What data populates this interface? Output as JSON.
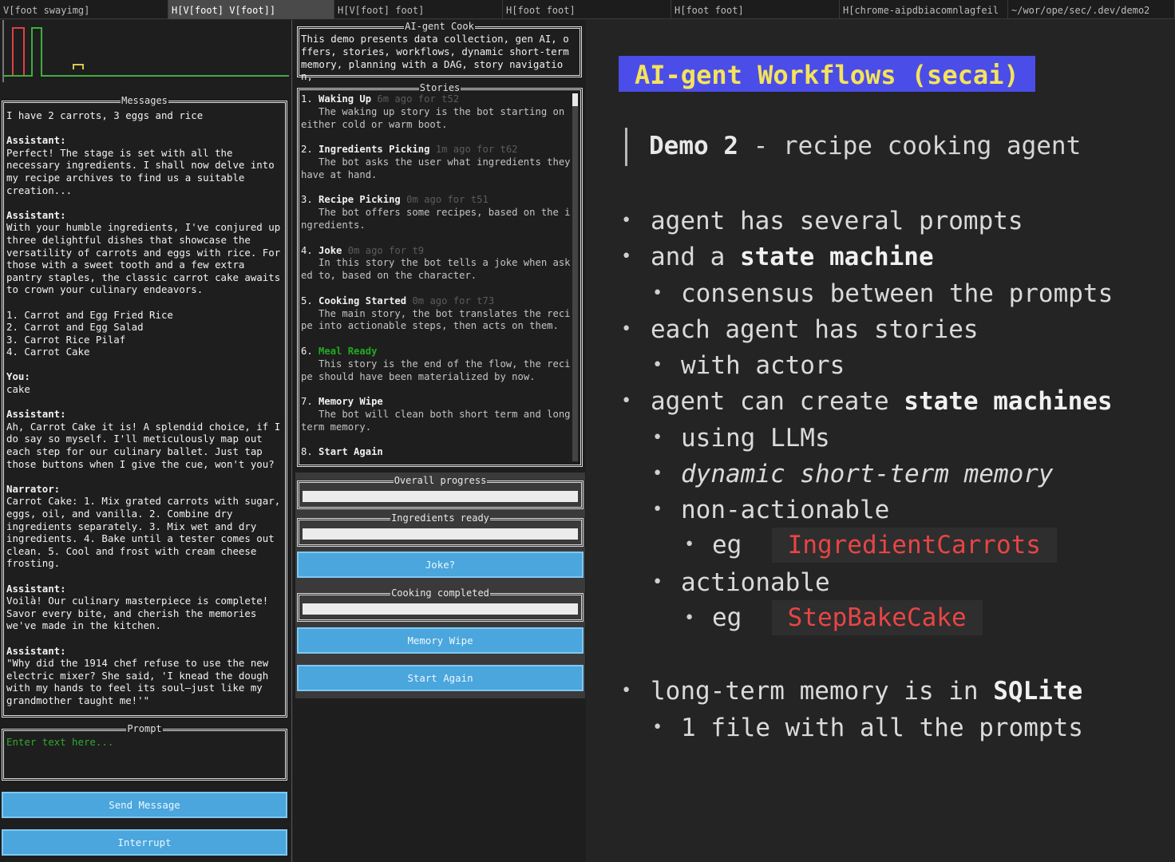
{
  "tabs": [
    {
      "label": "V[foot swayimg]",
      "active": false
    },
    {
      "label": "H[V[foot] V[foot]]",
      "active": true
    },
    {
      "label": "H[V[foot] foot]",
      "active": false
    },
    {
      "label": "H[foot foot]",
      "active": false
    },
    {
      "label": "H[foot foot]",
      "active": false
    },
    {
      "label": "H[chrome-aipdbiacomnlagfeil",
      "active": false
    },
    {
      "label": "~/wor/ope/sec/.dev/demo2",
      "active": false
    }
  ],
  "messages": {
    "title": "Messages",
    "items": [
      {
        "role": "",
        "text": "I have 2 carrots, 3 eggs and rice"
      },
      {
        "role": "Assistant:",
        "text": "Perfect! The stage is set with all the\nnecessary ingredients. I shall now delve into\nmy recipe archives to find us a suitable\ncreation..."
      },
      {
        "role": "Assistant:",
        "text": "With your humble ingredients, I've conjured up\nthree delightful dishes that showcase the\nversatility of carrots and eggs with rice. For\nthose with a sweet tooth and a few extra\npantry staples, the classic carrot cake awaits\nto crown your culinary endeavors.\n\n1. Carrot and Egg Fried Rice\n2. Carrot and Egg Salad\n3. Carrot Rice Pilaf\n4. Carrot Cake"
      },
      {
        "role": "You:",
        "text": "cake"
      },
      {
        "role": "Assistant:",
        "text": "Ah, Carrot Cake it is! A splendid choice, if I\ndo say so myself. I'll meticulously map out\neach step for our culinary ballet. Just tap\nthose buttons when I give the cue, won't you?"
      },
      {
        "role": "Narrator:",
        "text": "Carrot Cake: 1. Mix grated carrots with sugar,\neggs, oil, and vanilla. 2. Combine dry\ningredients separately. 3. Mix wet and dry\ningredients. 4. Bake until a tester comes out\nclean. 5. Cool and frost with cream cheese\nfrosting."
      },
      {
        "role": "Assistant:",
        "text": "Voilà! Our culinary masterpiece is complete!\nSavor every bite, and cherish the memories\nwe've made in the kitchen."
      },
      {
        "role": "Assistant:",
        "text": "\"Why did the 1914 chef refuse to use the new\nelectric mixer? She said, 'I knead the dough\nwith my hands to feel its soul—just like my\ngrandmother taught me!'\""
      }
    ]
  },
  "prompt": {
    "title": "Prompt",
    "placeholder": "Enter text here..."
  },
  "buttons": {
    "send": "Send Message",
    "interrupt": "Interrupt"
  },
  "about": {
    "title": "AI-gent Cook",
    "text": "This demo presents data collection, gen AI, offers, stories, workflows, dynamic short-term memory, planning with a DAG, story navigation,"
  },
  "stories": {
    "title": "Stories",
    "items": [
      {
        "num": "1.",
        "name": "Waking Up",
        "meta": "6m ago for t52",
        "desc": "The waking up story is the bot starting on either cold or warm boot.",
        "color": "#f0f0f0"
      },
      {
        "num": "2.",
        "name": "Ingredients Picking",
        "meta": "1m ago for t62",
        "desc": "The bot asks the user what ingredients they have at hand.",
        "color": "#f0f0f0"
      },
      {
        "num": "3.",
        "name": "Recipe Picking",
        "meta": "0m ago for t51",
        "desc": "The bot offers some recipes, based on the ingredients.",
        "color": "#f0f0f0"
      },
      {
        "num": "4.",
        "name": "Joke",
        "meta": "0m ago for t9",
        "desc": "In this story the bot tells a joke when asked to, based on the character.",
        "color": "#f0f0f0"
      },
      {
        "num": "5.",
        "name": "Cooking Started",
        "meta": "0m ago for t73",
        "desc": "The main story, the bot translates the recipe into actionable steps, then acts on them.",
        "color": "#f0f0f0"
      },
      {
        "num": "6.",
        "name": "Meal Ready",
        "meta": "",
        "desc": "This story is the end of the flow, the recipe should have been materialized by now.",
        "color": "#22aa22"
      },
      {
        "num": "7.",
        "name": "Memory Wipe",
        "meta": "",
        "desc": "The bot will clean both short term and long term memory.",
        "color": "#f0f0f0"
      },
      {
        "num": "8.",
        "name": "Start Again",
        "meta": "",
        "desc": "",
        "color": "#f0f0f0"
      }
    ]
  },
  "controls": {
    "overall_progress": {
      "title": "Overall progress",
      "value": 0
    },
    "ingredients_ready": {
      "title": "Ingredients ready",
      "value": 0
    },
    "joke_button": "Joke?",
    "cooking_completed": {
      "title": "Cooking completed",
      "value": 0
    },
    "memory_wipe_button": "Memory Wipe",
    "start_again_button": "Start Again"
  },
  "slide": {
    "title": "AI-gent Workflows (secai)",
    "subtitle_bold": "Demo 2",
    "subtitle_rest": " - recipe cooking agent",
    "bullets": {
      "b1": "agent has several prompts",
      "b2_pre": "and a ",
      "b2_bold": "state machine",
      "b2_1": "consensus between the prompts",
      "b3": "each agent has stories",
      "b3_1": "with actors",
      "b4_pre": "agent can create ",
      "b4_bold": "state machines",
      "b4_1": "using LLMs",
      "b4_2": "dynamic short-term memory",
      "b4_3": "non-actionable",
      "b4_3_eg": "eg",
      "b4_3_code": "IngredientCarrots",
      "b4_4": "actionable",
      "b4_4_eg": "eg",
      "b4_4_code": "StepBakeCake",
      "b5_pre": "long-term memory is in ",
      "b5_bold": "SQLite",
      "b5_1": "1 file with all the prompts"
    }
  },
  "colors": {
    "accent_blue": "#4aa6dc",
    "title_bg": "#4b4de8",
    "title_fg": "#f5e35a",
    "code_red": "#e84545",
    "prompt_green": "#2faa2f",
    "graph_red": "#e04040",
    "graph_green": "#3fae3f",
    "graph_yellow": "#d8c84a"
  }
}
